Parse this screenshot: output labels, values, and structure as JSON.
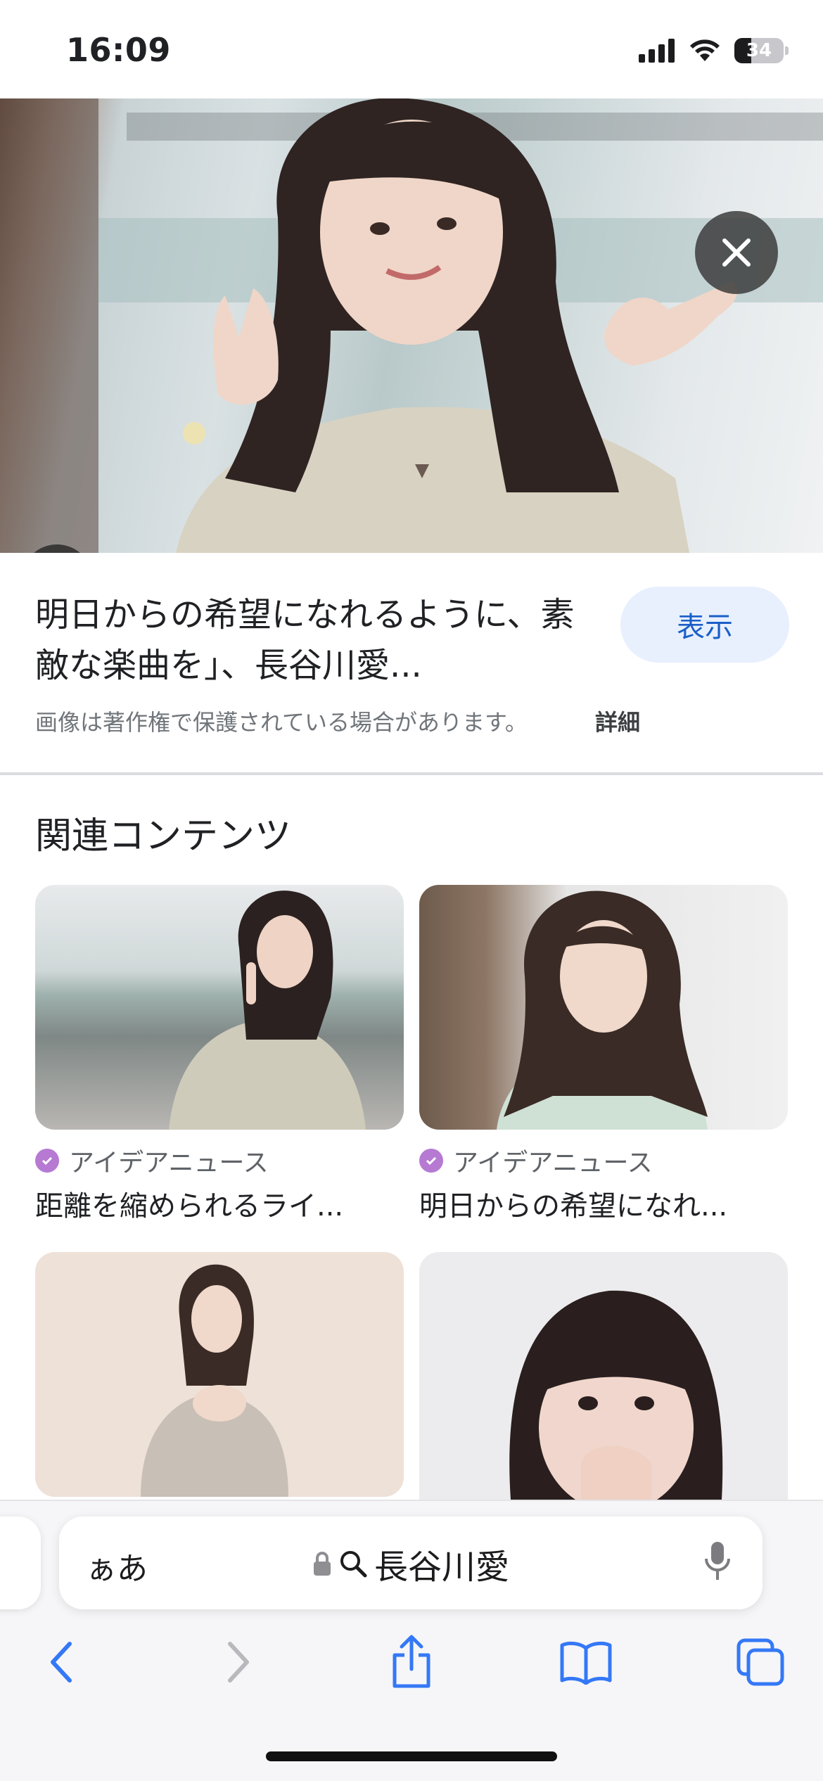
{
  "status_bar": {
    "time": "16:09",
    "battery": "34",
    "battery_level": 0.34
  },
  "image_viewer": {
    "title": "明日からの希望になれるように、素敵な楽曲を」、長谷川愛...",
    "view_button": "表示",
    "copyright_notice": "画像は著作権で保護されている場合があります。",
    "details_link": "詳細"
  },
  "related": {
    "heading": "関連コンテンツ",
    "items": [
      {
        "source": "アイデアニュース",
        "title": "距離を縮められるライ..."
      },
      {
        "source": "アイデアニュース",
        "title": "明日からの希望になれ..."
      },
      {
        "source": "",
        "title": ""
      },
      {
        "source": "",
        "title": ""
      }
    ]
  },
  "browser": {
    "text_size_button": "ぁあ",
    "address": "長谷川愛"
  },
  "icons": {
    "close": "close-icon",
    "lens": "google-lens-icon",
    "lock": "lock-icon",
    "search": "search-icon",
    "mic": "microphone-icon",
    "back": "back-chevron-icon",
    "forward": "forward-chevron-icon",
    "share": "share-icon",
    "bookmarks": "bookmarks-icon",
    "tabs": "tabs-icon"
  },
  "colors": {
    "accent": "#1a5fc7",
    "safari_blue": "#3478f6",
    "verified": "#b67ad3"
  }
}
